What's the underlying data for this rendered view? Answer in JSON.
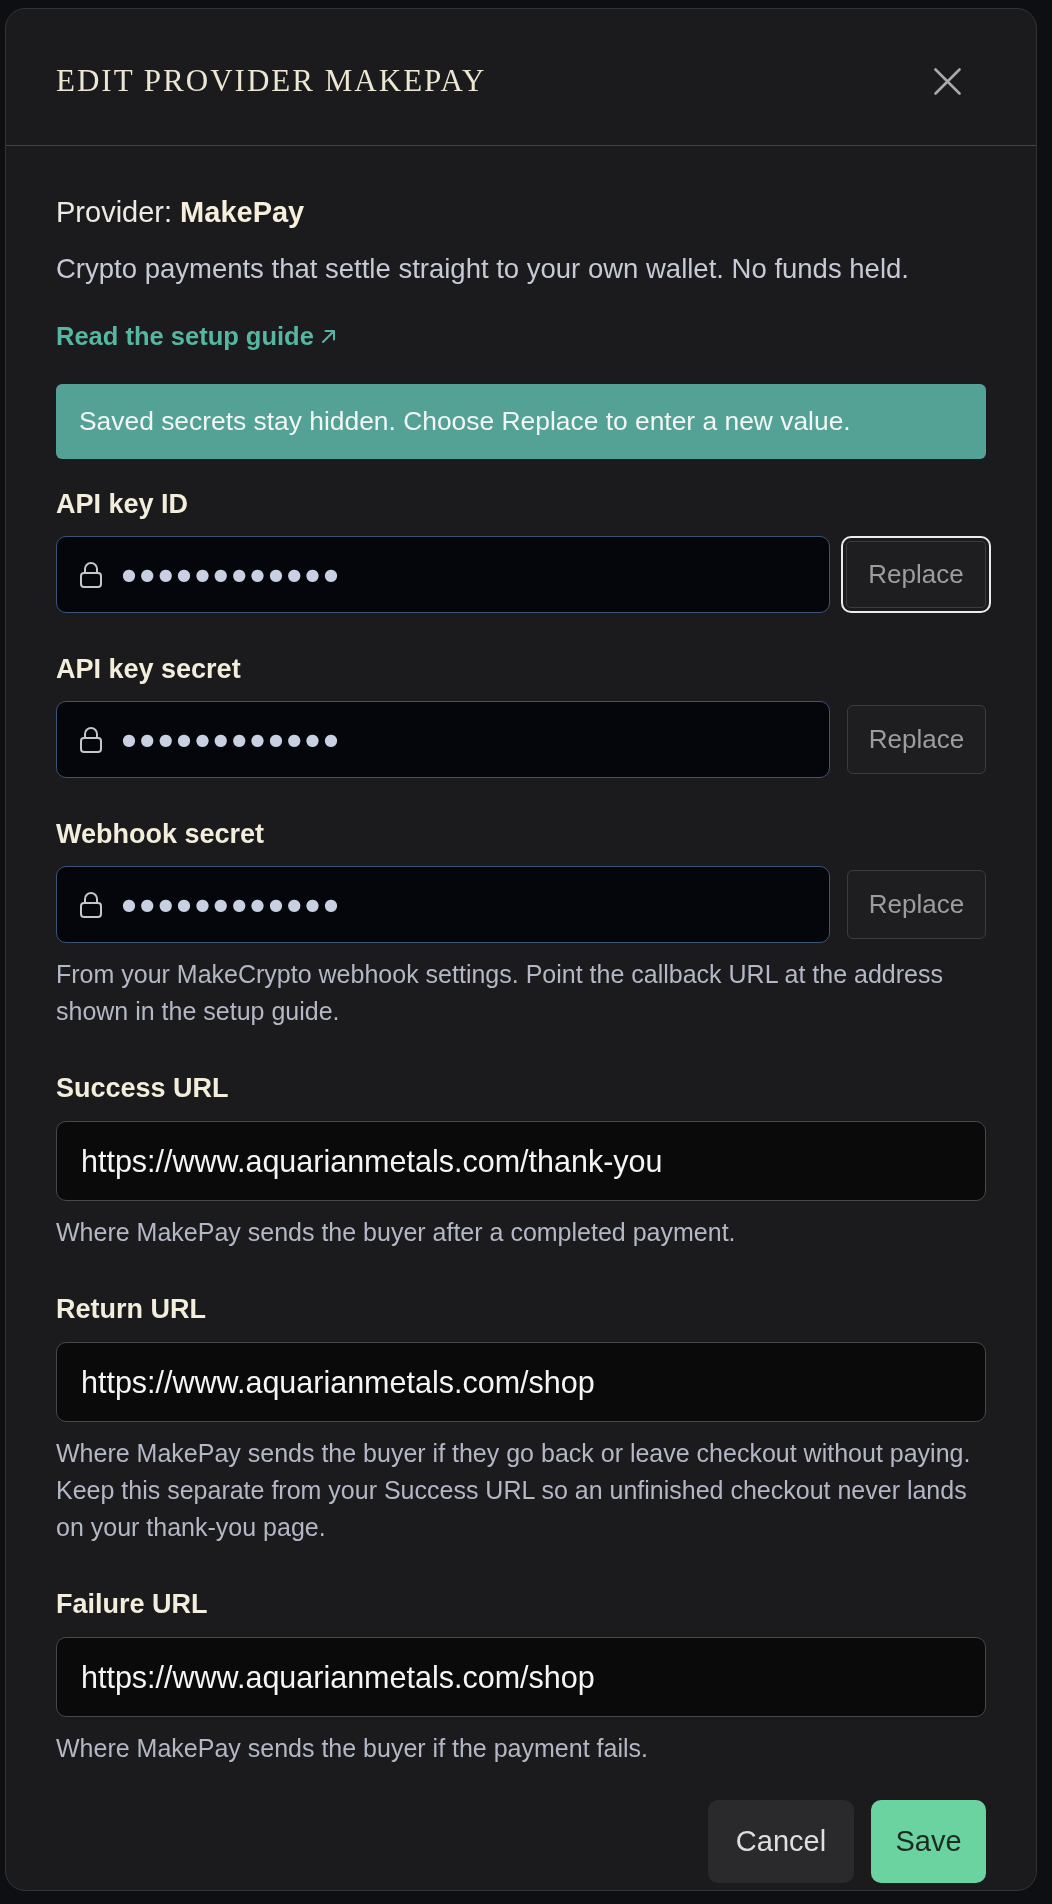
{
  "dialog": {
    "title": "EDIT PROVIDER MAKEPAY"
  },
  "provider_line": "Provider: **MakePay**",
  "description": "Crypto payments that settle straight to your own wallet. No funds held.",
  "guide_link": {
    "label": "Read the setup guide"
  },
  "notice": "Saved secrets stay hidden. Choose Replace to enter a new value.",
  "fields": [
    {
      "kind": "secret",
      "label": "API key ID",
      "value": "●●●●●●●●●●●●",
      "button": {
        "label": "Replace",
        "focused": true
      }
    },
    {
      "kind": "secret",
      "label": "API key secret",
      "value": "●●●●●●●●●●●●",
      "button": {
        "label": "Replace",
        "focused": false
      }
    },
    {
      "kind": "secret",
      "label": "Webhook secret",
      "value": "●●●●●●●●●●●●",
      "button": {
        "label": "Replace",
        "focused": false
      },
      "hint": "From your MakeCrypto webhook settings. Point the callback URL at the address shown in the setup guide."
    },
    {
      "kind": "url",
      "label": "Success URL",
      "value": "https://www.aquarianmetals.com/thank-you",
      "hint": "Where MakePay sends the buyer after a completed payment."
    },
    {
      "kind": "url",
      "label": "Return URL",
      "value": "https://www.aquarianmetals.com/shop",
      "hint": "Where MakePay sends the buyer if they go back or leave checkout without paying. Keep this separate from your Success URL so an unfinished checkout never lands on your thank-you page."
    },
    {
      "kind": "url",
      "label": "Failure URL",
      "value": "https://www.aquarianmetals.com/shop",
      "hint": "Where MakePay sends the buyer if the payment fails."
    }
  ],
  "actions": [
    {
      "kind": "secondary",
      "label": "Cancel"
    },
    {
      "kind": "primary",
      "label": "Save"
    }
  ]
}
